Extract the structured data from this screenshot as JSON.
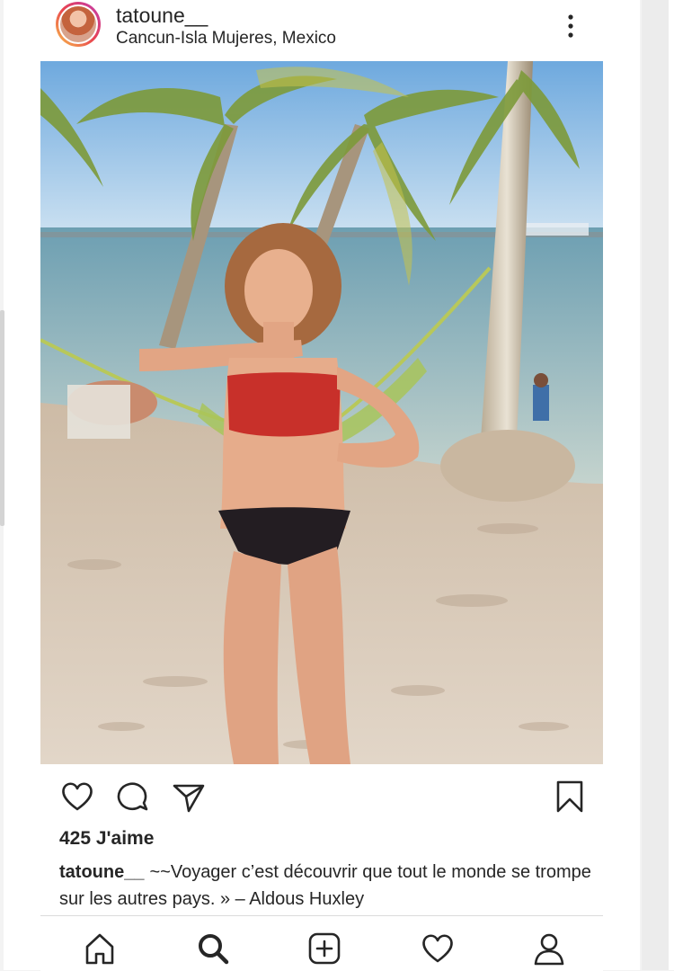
{
  "post": {
    "username": "tatoune__",
    "location": "Cancun-Isla Mujeres, Mexico",
    "likes_text": "425 J'aime",
    "caption_user": "tatoune__",
    "caption_text": "~~Voyager c’est découvrir que tout le monde se trompe sur les autres pays. » – Aldous Huxley"
  },
  "header": {
    "more_icon": "more-vertical-icon"
  },
  "actions": {
    "icons": [
      "heart-icon",
      "comment-icon",
      "share-icon",
      "bookmark-icon"
    ]
  },
  "nav": {
    "icons": [
      "home-icon",
      "search-icon",
      "add-post-icon",
      "activity-heart-icon",
      "profile-icon"
    ]
  },
  "colors": {
    "text": "#262626",
    "divider": "#dbdbdb",
    "story_ring_start": "#f9c04a",
    "story_ring_end": "#c23bb1"
  }
}
